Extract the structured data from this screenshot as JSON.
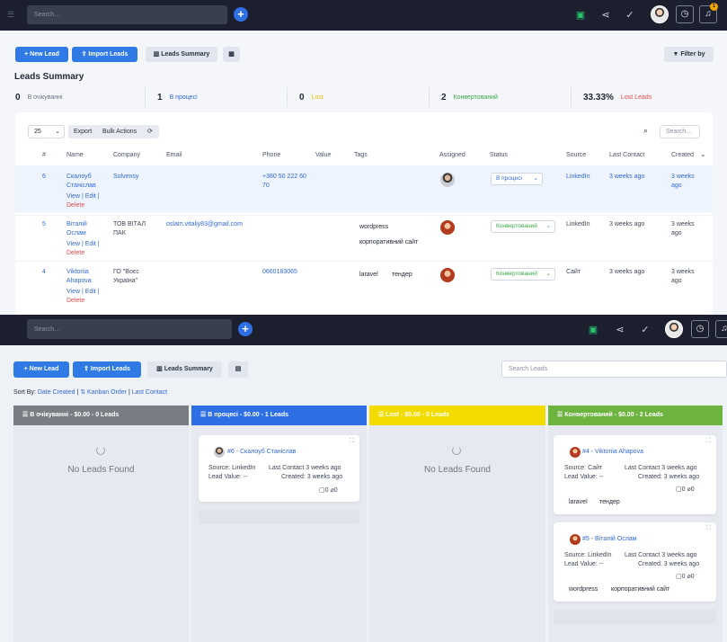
{
  "nav": {
    "search_placeholder": "Search...",
    "notif_count": "1"
  },
  "toolbar": {
    "new_lead": "+ New Lead",
    "import_leads": "⇪ Import Leads",
    "leads_summary": "Leads Summary",
    "filter_by": "Filter by"
  },
  "summary": {
    "title": "Leads Summary",
    "items": [
      {
        "count": "0",
        "label": "В очікуванні",
        "color": "#6b7280"
      },
      {
        "count": "1",
        "label": "В процесі",
        "color": "#3168d8"
      },
      {
        "count": "0",
        "label": "Lost",
        "color": "#e3c200"
      },
      {
        "count": "2",
        "label": "Конвертований",
        "color": "#3aa648"
      },
      {
        "count": "33.33%",
        "label": "Lost Leads",
        "color": "#e44b4b"
      }
    ]
  },
  "table": {
    "page_size": "25",
    "export": "Export",
    "bulk_actions": "Bulk Actions",
    "search_placeholder": "Search...",
    "columns": [
      "#",
      "Name",
      "Company",
      "Email",
      "Phone",
      "Value",
      "Tags",
      "Assigned",
      "Status",
      "Source",
      "Last Contact",
      "Created"
    ],
    "rows": [
      {
        "id": "6",
        "name": "Скалоуб Станіслав",
        "actions": "View | Edit |",
        "delete": "Delete",
        "company": "Solvensy",
        "email": "",
        "phone": "+380 50 222 60 70",
        "tags": [],
        "status": "В процесі",
        "source": "LinkedIn",
        "last_contact": "3 weeks ago",
        "created": "3 weeks ago"
      },
      {
        "id": "5",
        "name": "Віталій Ослам",
        "actions": "View | Edit |",
        "delete": "Delete",
        "company": "ТОВ ВІТАЛ ПАК",
        "email": "oslam.vitaliy83@gmail.com",
        "phone": "",
        "tags": [
          "wordpress",
          "корпоративний сайт"
        ],
        "status": "Конвертований",
        "source": "LinkedIn",
        "last_contact": "3 weeks ago",
        "created": "3 weeks ago"
      },
      {
        "id": "4",
        "name": "Viktoriia Ahapova",
        "actions": "View | Edit |",
        "delete": "Delete",
        "company": "ГО \"Воєс Україна\"",
        "email": "",
        "phone": "0660183065",
        "tags": [
          "laravel",
          "тендер"
        ],
        "status": "Конвертований",
        "source": "Сайт",
        "last_contact": "3 weeks ago",
        "created": "3 weeks ago"
      }
    ]
  },
  "kanban": {
    "search_placeholder": "Search Leads",
    "sort_by_label": "Sort By:",
    "sort_options": [
      "Date Created",
      "Kanban Order",
      "Last Contact"
    ],
    "columns": [
      {
        "title": "В очікуванні - $0.00 - 0 Leads",
        "color": "#7a7d84",
        "empty": "No Leads Found"
      },
      {
        "title": "В процесі - $0.00 - 1 Leads",
        "color": "#2f6fe6"
      },
      {
        "title": "Lost - $0.00 - 0 Leads",
        "color": "#f2dc00",
        "empty": "No Leads Found"
      },
      {
        "title": "Конвертований - $0.00 - 2 Leads",
        "color": "#6db33f"
      }
    ],
    "cards": [
      {
        "title": "#6 - Скалоуб Станіслав",
        "source": "Source: LinkedIn",
        "last_contact": "Last Contact 3 weeks ago",
        "value": "Lead Value: --",
        "created": "Created: 3 weeks ago",
        "tasks": "0",
        "files": "0",
        "tags": []
      },
      {
        "title": "#4 - Viktoriia Ahapova",
        "source": "Source: Сайт",
        "last_contact": "Last Contact 3 weeks ago",
        "value": "Lead Value: --",
        "created": "Created: 3 weeks ago",
        "tasks": "0",
        "files": "0",
        "tags": [
          "laravel",
          "тендер"
        ]
      },
      {
        "title": "#5 - Віталій Ослам",
        "source": "Source: LinkedIn",
        "last_contact": "Last Contact 3 weeks ago",
        "value": "Lead Value: --",
        "created": "Created: 3 weeks ago",
        "tasks": "0",
        "files": "0",
        "tags": [
          "wordpress",
          "корпоративний сайт"
        ]
      }
    ]
  }
}
